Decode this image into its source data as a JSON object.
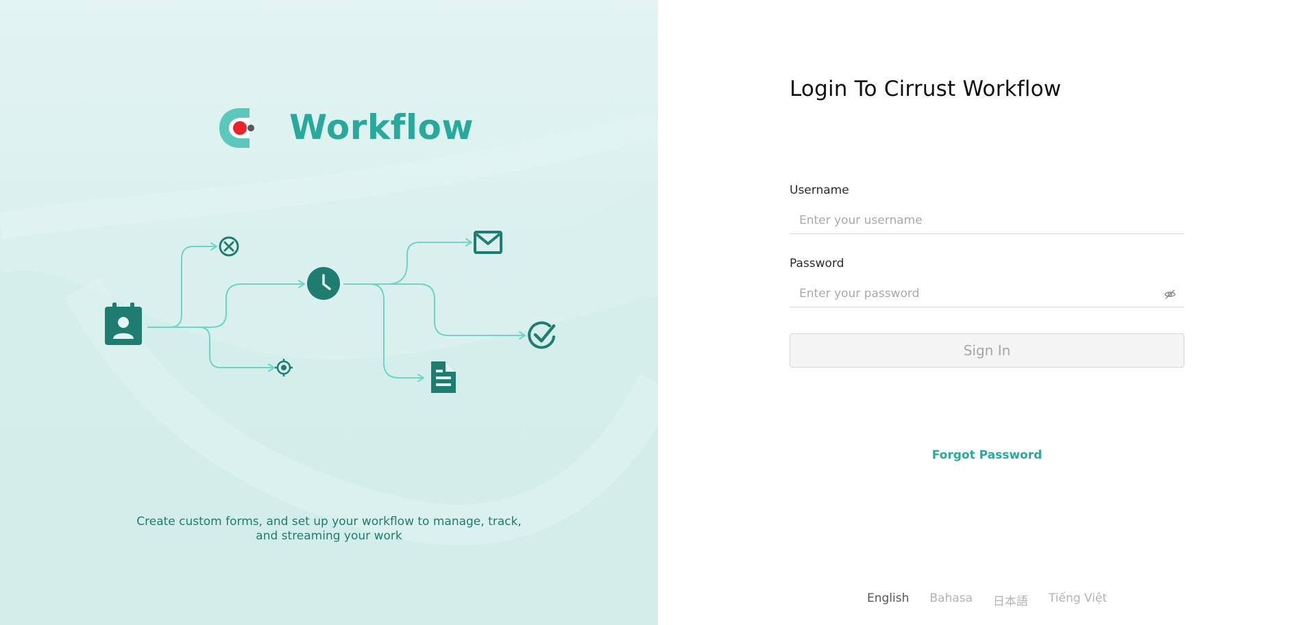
{
  "brand": {
    "name": "Workflow",
    "accent_color": "#2aa89c",
    "dark_color": "#1e7c70",
    "logo_dot_color": "#e8232b"
  },
  "illustration": {
    "icons": [
      "contact-calendar-icon",
      "cancel-circle-icon",
      "target-icon",
      "clock-icon",
      "mail-icon",
      "check-circle-icon",
      "document-icon"
    ]
  },
  "tagline": {
    "line1": "Create custom forms, and set up your workflow to manage, track,",
    "line2": "and streaming your work"
  },
  "login": {
    "title": "Login To Cirrust Workflow",
    "username_label": "Username",
    "username_placeholder": "Enter your username",
    "username_value": "",
    "password_label": "Password",
    "password_placeholder": "Enter your password",
    "password_value": "",
    "signin_label": "Sign In",
    "forgot_label": "Forgot Password"
  },
  "languages": [
    {
      "label": "English",
      "active": true
    },
    {
      "label": "Bahasa",
      "active": false
    },
    {
      "label": "日本語",
      "active": false
    },
    {
      "label": "Tiếng Việt",
      "active": false
    }
  ]
}
